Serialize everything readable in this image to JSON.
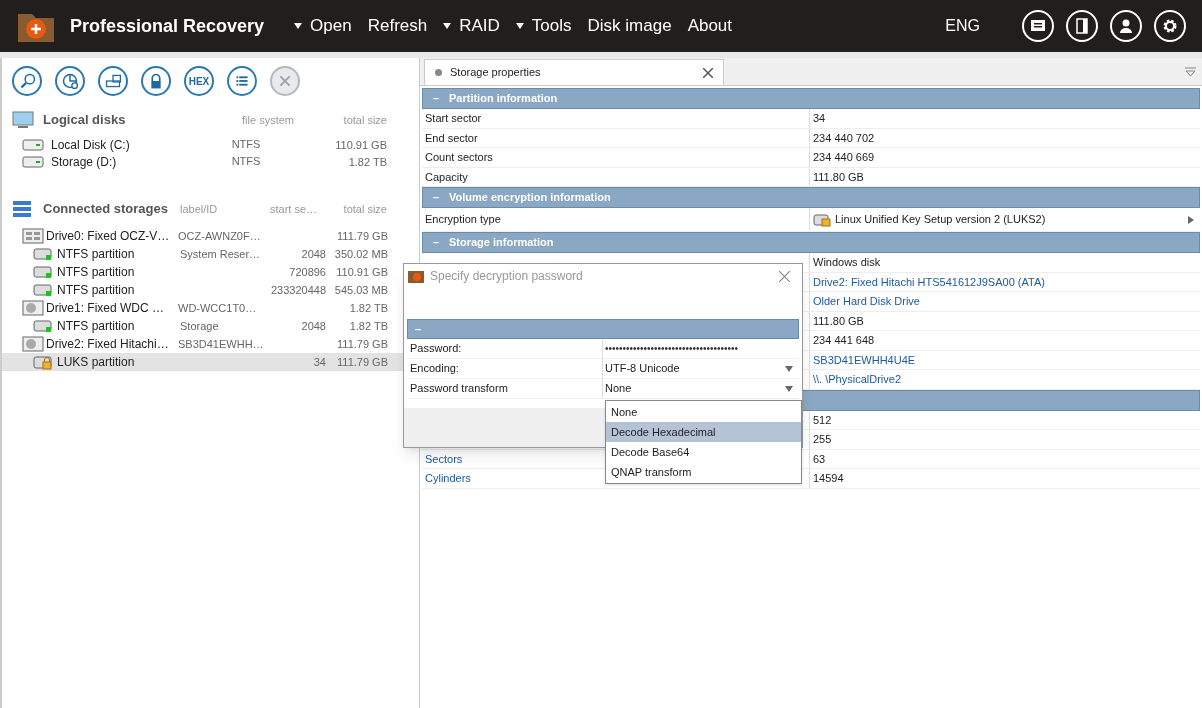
{
  "app": {
    "title": "Professional Recovery"
  },
  "menu": [
    {
      "label": "Open",
      "caret": true
    },
    {
      "label": "Refresh",
      "caret": false
    },
    {
      "label": "RAID",
      "caret": true
    },
    {
      "label": "Tools",
      "caret": true
    },
    {
      "label": "Disk image",
      "caret": false
    },
    {
      "label": "About",
      "caret": false
    }
  ],
  "language": "ENG",
  "toolbar": [
    {
      "kind": "search"
    },
    {
      "kind": "pie"
    },
    {
      "kind": "drive"
    },
    {
      "kind": "lock"
    },
    {
      "kind": "hex",
      "label": "HEX"
    },
    {
      "kind": "list"
    },
    {
      "kind": "close",
      "disabled": true
    }
  ],
  "logical_disks": {
    "title": "Logical disks",
    "columns": [
      "file system",
      "total size"
    ],
    "items": [
      {
        "name": "Local Disk (C:)",
        "fs": "NTFS",
        "size": "110.91 GB"
      },
      {
        "name": "Storage (D:)",
        "fs": "NTFS",
        "size": "1.82 TB"
      }
    ]
  },
  "connected_storages": {
    "title": "Connected storages",
    "columns": [
      "label/ID",
      "start se…",
      "total size"
    ],
    "items": [
      {
        "kind": "ssd",
        "name": "Drive0: Fixed OCZ-V…",
        "label": "OCZ-AWNZ0F…",
        "size": "111.79 GB",
        "selected": false,
        "children": [
          {
            "kind": "partition",
            "name": "NTFS partition",
            "label": "System Reser…",
            "start": "2048",
            "size": "350.02 MB",
            "selected": false
          },
          {
            "kind": "partition",
            "name": "NTFS partition",
            "start": "720896",
            "size": "110.91 GB",
            "selected": false
          },
          {
            "kind": "partition",
            "name": "NTFS partition",
            "start": "233320448",
            "size": "545.03 MB",
            "selected": false
          }
        ]
      },
      {
        "kind": "hdd",
        "name": "Drive1: Fixed WDC …",
        "label": "WD-WCC1T0…",
        "size": "1.82 TB",
        "selected": false,
        "children": [
          {
            "kind": "partition",
            "name": "NTFS partition",
            "label": "Storage",
            "start": "2048",
            "size": "1.82 TB",
            "selected": false
          }
        ]
      },
      {
        "kind": "hdd",
        "name": "Drive2: Fixed Hitachi…",
        "label": "SB3D41EWHH…",
        "size": "111.79 GB",
        "selected": false,
        "children": [
          {
            "kind": "luks",
            "name": "LUKS partition",
            "start": "34",
            "size": "111.79 GB",
            "selected": true
          }
        ]
      }
    ]
  },
  "tab": {
    "label": "Storage properties"
  },
  "sections": [
    {
      "toggle": "–",
      "title": "Partition information",
      "rows": [
        {
          "label": "Start sector",
          "value": "34",
          "link": false
        },
        {
          "label": "End sector",
          "value": "234 440 702",
          "link": false
        },
        {
          "label": "Count sectors",
          "value": "234 440 669",
          "link": false
        },
        {
          "label": "Capacity",
          "value": "111.80 GB",
          "link": false
        }
      ]
    },
    {
      "toggle": "–",
      "title": "Volume encryption information",
      "rows": [
        {
          "label": "Encryption type",
          "value": "Linux Unified Key Setup version 2 (LUKS2)",
          "link": false,
          "kind": "encryption"
        }
      ]
    },
    {
      "toggle": "–",
      "title": "Storage information",
      "rows": [
        {
          "value": "Windows disk",
          "link": false
        },
        {
          "value": "Drive2: Fixed Hitachi HTS541612J9SA00 (ATA)",
          "link": true
        },
        {
          "value": "Older Hard Disk Drive",
          "link": true
        },
        {
          "value": "111.80 GB",
          "link": false
        },
        {
          "value": "234 441 648",
          "link": false
        },
        {
          "value": "SB3D41EWHH4U4E",
          "link": true
        },
        {
          "value": "\\\\. \\PhysicalDrive2",
          "link": true
        }
      ]
    },
    {
      "rows": [
        {
          "value": "512",
          "link": false
        },
        {
          "value": "255",
          "link": false
        },
        {
          "label": "Sectors",
          "value": "63",
          "link": false
        },
        {
          "label": "Cylinders",
          "value": "14594",
          "link": false
        }
      ]
    }
  ],
  "dialog": {
    "title": "Specify decryption password",
    "toggle": "–",
    "rows": [
      {
        "kind": "password",
        "label": "Password:",
        "value": "••••••••••••••••••••••••••••••••••••••"
      },
      {
        "kind": "select",
        "label": "Encoding:",
        "value": "UTF-8 Unicode"
      },
      {
        "kind": "select",
        "label": "Password transform",
        "value": "None"
      }
    ],
    "dropdown": [
      {
        "label": "None",
        "selected": false
      },
      {
        "label": "Decode Hexadecimal",
        "selected": true
      },
      {
        "label": "Decode Base64",
        "selected": false
      },
      {
        "label": "QNAP transform",
        "selected": false
      }
    ]
  }
}
